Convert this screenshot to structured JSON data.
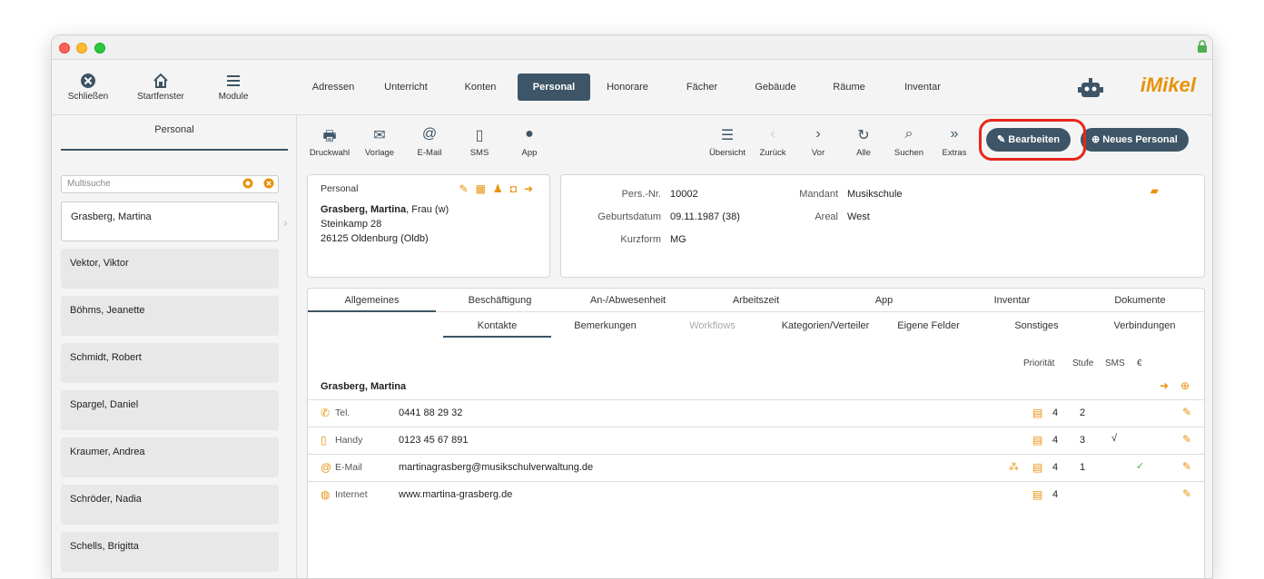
{
  "topnav": {
    "buttons": [
      {
        "label": "Schließen",
        "icon": "close-circle-icon"
      },
      {
        "label": "Startfenster",
        "icon": "home-icon"
      },
      {
        "label": "Module",
        "icon": "menu-icon"
      }
    ],
    "modules": [
      "Adressen",
      "Unterricht",
      "Konten",
      "Personal",
      "Honorare",
      "Fächer",
      "Gebäude",
      "Räume",
      "Inventar"
    ],
    "active_module": "Personal",
    "logo": "iMikel"
  },
  "sidebar": {
    "title": "Personal",
    "search_placeholder": "Multisuche",
    "persons": [
      "Grasberg, Martina",
      "Vektor, Viktor",
      "Böhms, Jeanette",
      "Schmidt, Robert",
      "Spargel, Daniel",
      "Kraumer, Andrea",
      "Schröder, Nadia",
      "Schells, Brigitta"
    ]
  },
  "toolbar": {
    "left": [
      "Druckwahl",
      "Vorlage",
      "E-Mail",
      "SMS",
      "App"
    ],
    "right": [
      "Übersicht",
      "Zurück",
      "Vor",
      "Alle",
      "Suchen",
      "Extras"
    ],
    "edit_label": "Bearbeiten",
    "new_label": "Neues Personal"
  },
  "person_card": {
    "title": "Personal",
    "name_bold": "Grasberg, Martina",
    "name_suffix": ", Frau (w)",
    "street": "Steinkamp 28",
    "city": "26125 Oldenburg (Oldb)"
  },
  "info": {
    "persnr_label": "Pers.-Nr.",
    "persnr": "10002",
    "birth_label": "Geburtsdatum",
    "birth": "09.11.1987 (38)",
    "short_label": "Kurzform",
    "short": "MG",
    "mandant_label": "Mandant",
    "mandant": "Musikschule",
    "areal_label": "Areal",
    "areal": "West"
  },
  "tabs_main": [
    "Allgemeines",
    "Beschäftigung",
    "An-/Abwesenheit",
    "Arbeitszeit",
    "App",
    "Inventar",
    "Dokumente"
  ],
  "tabs_sub": [
    "Kontakte",
    "Bemerkungen",
    "Workflows",
    "Kategorien/Verteiler",
    "Eigene Felder",
    "Sonstiges",
    "Verbindungen"
  ],
  "contacts": {
    "headers": {
      "prio": "Priorität",
      "stufe": "Stufe",
      "sms": "SMS",
      "euro": "€"
    },
    "owner": "Grasberg, Martina",
    "rows": [
      {
        "label": "Tel.",
        "value": "0441 88 29 32",
        "prio": "4",
        "stufe": "2",
        "sms": "",
        "euro": ""
      },
      {
        "label": "Handy",
        "value": "0123 45 67 891",
        "prio": "4",
        "stufe": "3",
        "sms": "√",
        "euro": ""
      },
      {
        "label": "E-Mail",
        "value": "martinagrasberg@musikschulverwaltung.de",
        "prio": "4",
        "stufe": "1",
        "sms": "",
        "euro": "✓"
      },
      {
        "label": "Internet",
        "value": "www.martina-grasberg.de",
        "prio": "4",
        "stufe": "",
        "sms": "",
        "euro": ""
      }
    ]
  }
}
